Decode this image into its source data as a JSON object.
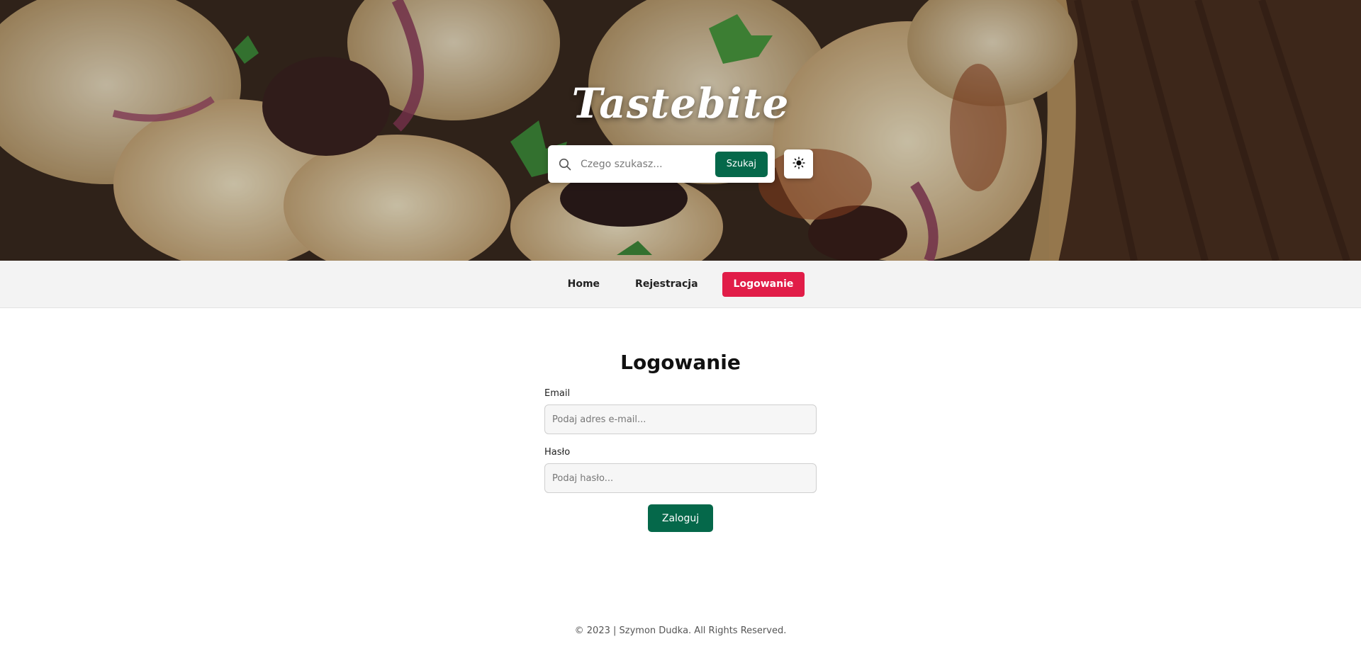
{
  "brand": {
    "title": "Tastebite"
  },
  "search": {
    "placeholder": "Czego szukasz...",
    "button_label": "Szukaj",
    "icon": "search-icon"
  },
  "theme_toggle": {
    "icon": "sun-icon"
  },
  "nav": {
    "items": [
      {
        "label": "Home",
        "active": false
      },
      {
        "label": "Rejestracja",
        "active": false
      },
      {
        "label": "Logowanie",
        "active": true
      }
    ],
    "active_color": "#e11d48"
  },
  "login": {
    "title": "Logowanie",
    "email_label": "Email",
    "email_placeholder": "Podaj adres e-mail...",
    "password_label": "Hasło",
    "password_placeholder": "Podaj hasło...",
    "submit_label": "Zaloguj"
  },
  "footer": {
    "text": "© 2023 | Szymon Dudka. All Rights Reserved."
  },
  "colors": {
    "primary": "#05684a",
    "accent": "#e11d48"
  }
}
